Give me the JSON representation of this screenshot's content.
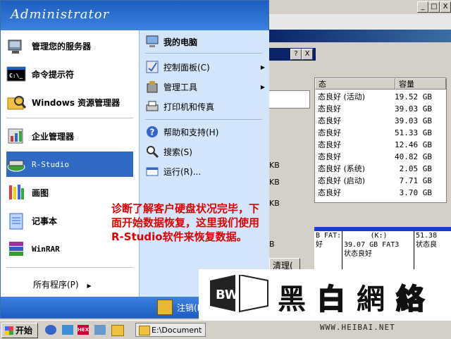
{
  "menu": {
    "username": "Administrator",
    "left_items": [
      {
        "label": "管理您的服务器",
        "icon": "server-icon"
      },
      {
        "label": "命令提示符",
        "icon": "command-prompt-icon"
      },
      {
        "label": "Windows 资源管理器",
        "icon": "explorer-icon"
      },
      {
        "label": "企业管理器",
        "icon": "enterprise-manager-icon"
      },
      {
        "label": "R-Studio",
        "icon": "r-studio-icon"
      },
      {
        "label": "画图",
        "icon": "paint-icon"
      },
      {
        "label": "记事本",
        "icon": "notepad-icon"
      },
      {
        "label": "WinRAR",
        "icon": "winrar-icon"
      }
    ],
    "all_programs": "所有程序(P)",
    "right_items": [
      {
        "label": "我的电脑",
        "bold": true
      },
      {
        "label": "控制面板(C)",
        "submenu": true
      },
      {
        "label": "管理工具",
        "submenu": true
      },
      {
        "label": "打印机和传真"
      },
      {
        "label": "帮助和支持(H)"
      },
      {
        "label": "搜索(S)"
      },
      {
        "label": "运行(R)..."
      }
    ],
    "logoff": "注销(L)"
  },
  "background": {
    "dialog_buttons": [
      "?",
      "X"
    ],
    "window_buttons": [
      "_",
      "□",
      "X"
    ],
    "columns": [
      "态",
      "容量"
    ],
    "rows": [
      {
        "status": "态良好 (活动)",
        "capacity": "19.52 GB"
      },
      {
        "status": "态良好",
        "capacity": "39.03 GB"
      },
      {
        "status": "态良好",
        "capacity": "39.03 GB"
      },
      {
        "status": "态良好",
        "capacity": "51.33 GB"
      },
      {
        "status": "态良好",
        "capacity": "12.46 GB"
      },
      {
        "status": "态良好",
        "capacity": "40.82 GB"
      },
      {
        "status": "态良好 (系统)",
        "capacity": "2.05 GB"
      },
      {
        "status": "态良好 (启动)",
        "capacity": "7.71 GB"
      },
      {
        "status": "态良好",
        "capacity": "3.70 GB"
      }
    ],
    "side_fragments": [
      "KB",
      "KB",
      "KB",
      "B"
    ],
    "button_fragment": "清理(",
    "disks": [
      {
        "l1": "B FAT:",
        "l2": "好"
      },
      {
        "l1": "(K:)",
        "l2": "39.07 GB FAT3",
        "l3": "状态良好"
      },
      {
        "l1": "",
        "l2": "51.38",
        "l3": "状态良"
      }
    ]
  },
  "caption": {
    "line1": "诊断了解客户硬盘状况完毕，下",
    "line2": "面开始数据恢复，这里我们使用",
    "line3": "R-Studio软件来恢复数据。"
  },
  "taskbar": {
    "start_label": "开始",
    "task_label": "E:\\Document",
    "hex_label": "HEX"
  },
  "watermark": {
    "chars": [
      "黑",
      "白",
      "網",
      "絡"
    ],
    "url": "WWW.HEIBAI.NET",
    "logo_text": "BW"
  },
  "colors": {
    "menu_blue": "#1c5ec0",
    "selected": "#316ac5",
    "caption_red": "#e00000"
  }
}
